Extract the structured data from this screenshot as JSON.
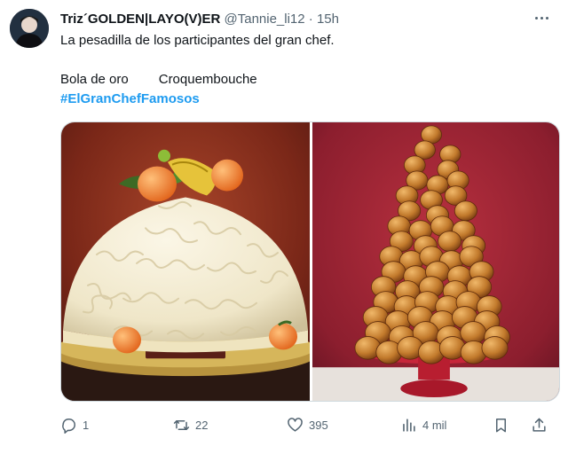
{
  "author": {
    "name": "Triz´GOLDEN|LAYO(V)ER",
    "handle": "@Tannie_li12",
    "separator": "·",
    "time": "15h"
  },
  "tweet": {
    "line1": "La pesadilla de los participantes del gran chef.",
    "item1": "Bola de oro",
    "item2": "Croquembouche",
    "hashtag": "#ElGranChefFamosos"
  },
  "media": {
    "left_alt_icon": "cake-dome-image",
    "right_alt_icon": "croquembouche-image"
  },
  "actions": {
    "replies": "1",
    "retweets": "22",
    "likes": "395",
    "views": "4 mil"
  },
  "colors": {
    "accent": "#1d9bf0",
    "muted": "#536471",
    "text": "#0f1419"
  }
}
